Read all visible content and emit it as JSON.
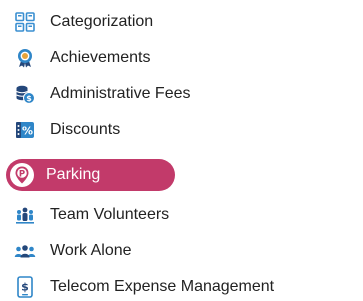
{
  "menu": {
    "items": [
      {
        "label": "Categorization",
        "icon": "categorization-grid-icon",
        "active": false
      },
      {
        "label": "Achievements",
        "icon": "achievement-medal-icon",
        "active": false
      },
      {
        "label": "Administrative Fees",
        "icon": "coins-dollar-icon",
        "active": false
      },
      {
        "label": "Discounts",
        "icon": "percent-tag-icon",
        "active": false
      },
      {
        "label": "Parking",
        "icon": "parking-pin-icon",
        "active": true
      },
      {
        "label": "Team Volunteers",
        "icon": "team-people-icon",
        "active": false
      },
      {
        "label": "Work Alone",
        "icon": "group-people-icon",
        "active": false
      },
      {
        "label": "Telecom Expense Management",
        "icon": "telecom-dollar-icon",
        "active": false
      }
    ],
    "colors": {
      "active_background": "#c23a6a",
      "icon_blue": "#2f86c8",
      "icon_navy": "#24477a"
    }
  }
}
